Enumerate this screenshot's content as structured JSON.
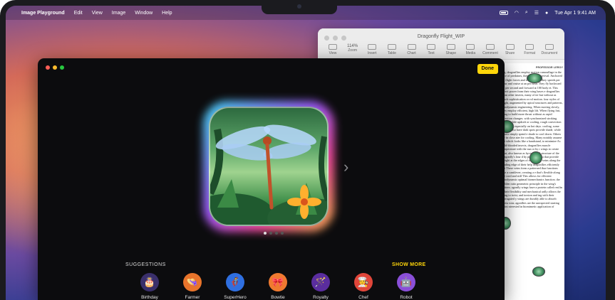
{
  "menubar": {
    "app_name": "Image Playground",
    "items": [
      "Edit",
      "View",
      "Image",
      "Window",
      "Help"
    ],
    "clock": "Tue Apr 1  9:41 AM"
  },
  "pages_window": {
    "title": "Dragonfly Flight_WIP",
    "zoom": "114%",
    "tools": [
      "View",
      "Zoom",
      "Insert",
      "Table",
      "Chart",
      "Text",
      "Shape",
      "Media",
      "Comment",
      "Share",
      "Format",
      "Document"
    ],
    "paper_header": "PROFESSOR LEROY",
    "paper_text": "ing, dragonflies employ motion camouflage in the face of predators, their agility is urvival. Anchored by flight forces and wings bases, they speeds per hour and cruise at an per hour. They fly backward up per second and forward at 100 body et. This direct power from their wing bases e dragonflies from other insects, many of ter but without as much sophistication or rol motion. four styles of flight, augmented by apical structures and patterns, aerodynamic engineering. When moving slowly, they employ efficient, high lift. When flying fast, cting to build more thrust without as rapid direction changes. with synchronized stroking. They e glide updraft or cooling, rough convection without n, especially on hot days. cooling, some species also have dark spots provide shade, while others simply spend e shade to cool down. Others fly in close ater for cooling. Many notably assume the which looks like a handstand, to minimize As cold-blooded insects, dragonflies muscle temperature with the sun or by r wings to create heat, also known as hysiological structure of the dragonfly's four d by pterostigmata that provide weight at the edges of each wing. veins along the leading edge of their help dragonflies efficiently cut These veins form a patterned ibar functions like a cantilever, creating a e that's flexible along the cord and stiff This allows for efficient aerodynamic optimal biomechanics function. the golden ratio geometric principle in the wing's pattern. agonfly wings have a protein called resilin r their flexibility and mechanical ardly allows the wing to twist, and torsion and ing with their corrugated y wings are durably able to absorb stress ions. agonflies are the unexpected starting point nterested in biomimetic application of"
  },
  "playground": {
    "done_label": "Done",
    "suggestions_title": "SUGGESTIONS",
    "show_more_label": "SHOW MORE",
    "page_count": 4,
    "current_page": 1,
    "suggestions": [
      {
        "label": "Birthday",
        "icon": "birthday-cake-icon",
        "bg": "#3a2f6b",
        "glyph": "🎂"
      },
      {
        "label": "Farmer",
        "icon": "farmer-hat-icon",
        "bg": "#e8742b",
        "glyph": "👒"
      },
      {
        "label": "SuperHero",
        "icon": "superhero-mask-icon",
        "bg": "#2f6fe0",
        "glyph": "🦸"
      },
      {
        "label": "Bowtie",
        "icon": "bowtie-icon",
        "bg": "#f07a30",
        "glyph": "🎀"
      },
      {
        "label": "Royalty",
        "icon": "scepter-icon",
        "bg": "#5a2d9e",
        "glyph": "🪄"
      },
      {
        "label": "Chef",
        "icon": "chef-hat-icon",
        "bg": "#e0463a",
        "glyph": "👨‍🍳"
      },
      {
        "label": "Robot",
        "icon": "robot-icon",
        "bg": "#8a4fd8",
        "glyph": "🤖"
      }
    ]
  }
}
